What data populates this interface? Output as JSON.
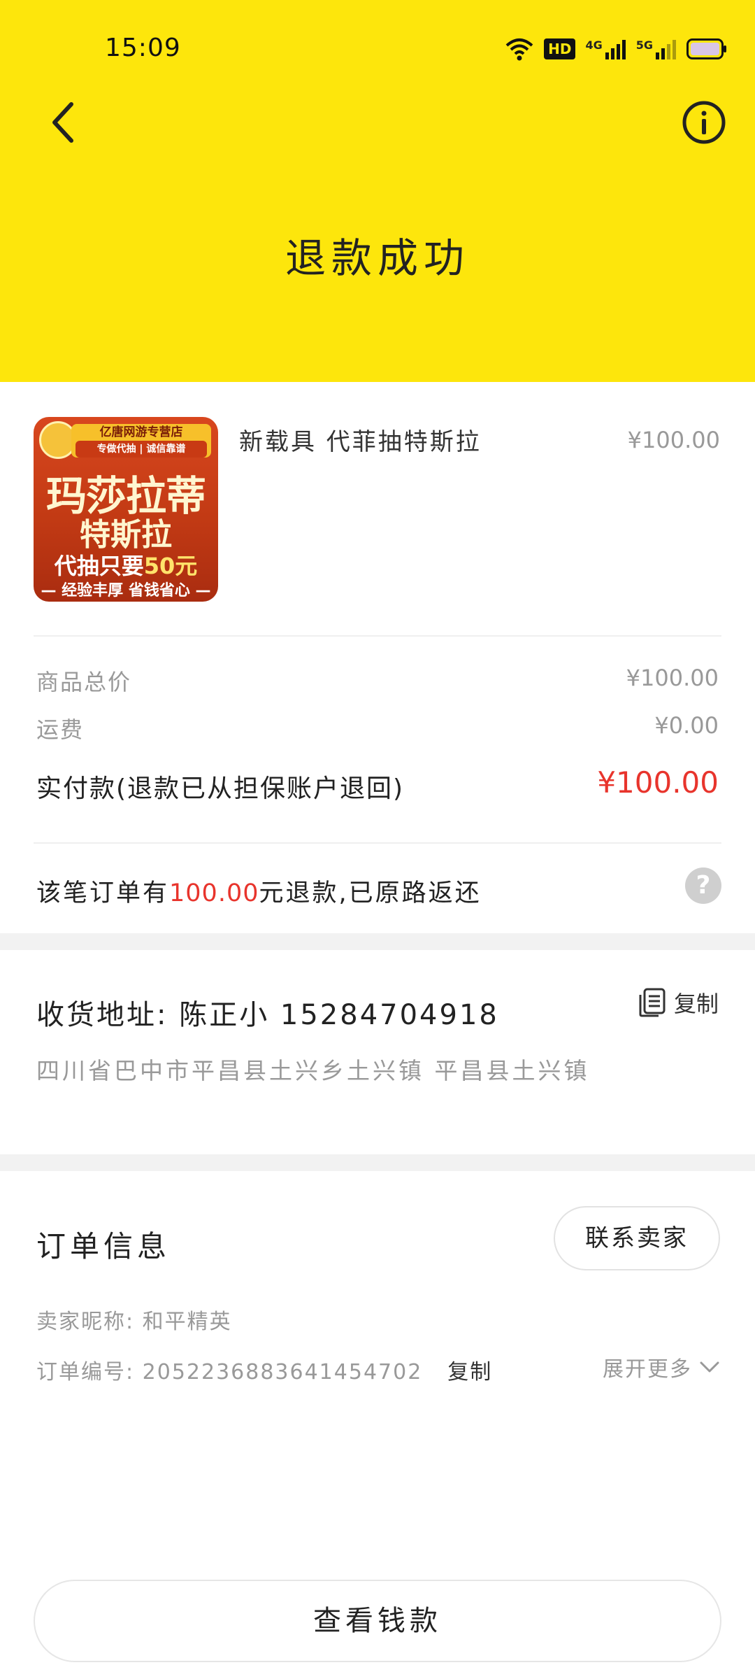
{
  "status_bar": {
    "time": "15:09",
    "hd_label": "HD",
    "signal_1_label": "4G",
    "signal_2_label": "5G"
  },
  "header": {
    "title": "退款成功",
    "background": "#FDE60C"
  },
  "product": {
    "name": "新载具 代菲抽特斯拉",
    "price": "¥100.00",
    "thumbnail": {
      "shop_badge": "亿唐网游专营店",
      "shop_sub": "专做代抽 | 诚信靠谱",
      "line1": "玛莎拉蒂",
      "line2": "特斯拉",
      "line3_prefix": "代抽只要",
      "line3_amount": "50元",
      "line4": "— 经验丰厚 省钱省心 —"
    }
  },
  "price_rows": [
    {
      "label": "商品总价",
      "value": "¥100.00"
    },
    {
      "label": "运费",
      "value": "¥0.00"
    },
    {
      "label": "实付款(退款已从担保账户退回)",
      "value": "¥100.00"
    }
  ],
  "refund_note": {
    "prefix": "该笔订单有",
    "amount": "100.00",
    "suffix": "元退款,已原路返还"
  },
  "address": {
    "title": "收货地址:  陈正小  15284704918",
    "copy_label": "复制",
    "detail": "四川省巴中市平昌县土兴乡土兴镇 平昌县土兴镇"
  },
  "order_info": {
    "title": "订单信息",
    "contact_label": "联系卖家",
    "seller": "卖家昵称: 和平精英",
    "order_no": "订单编号: 2052236883641454702",
    "copy_label": "复制",
    "expand_label": "展开更多"
  },
  "bottom_button": {
    "label": "查看钱款"
  },
  "colors": {
    "accent_red": "#e8342c",
    "muted": "#999999"
  }
}
